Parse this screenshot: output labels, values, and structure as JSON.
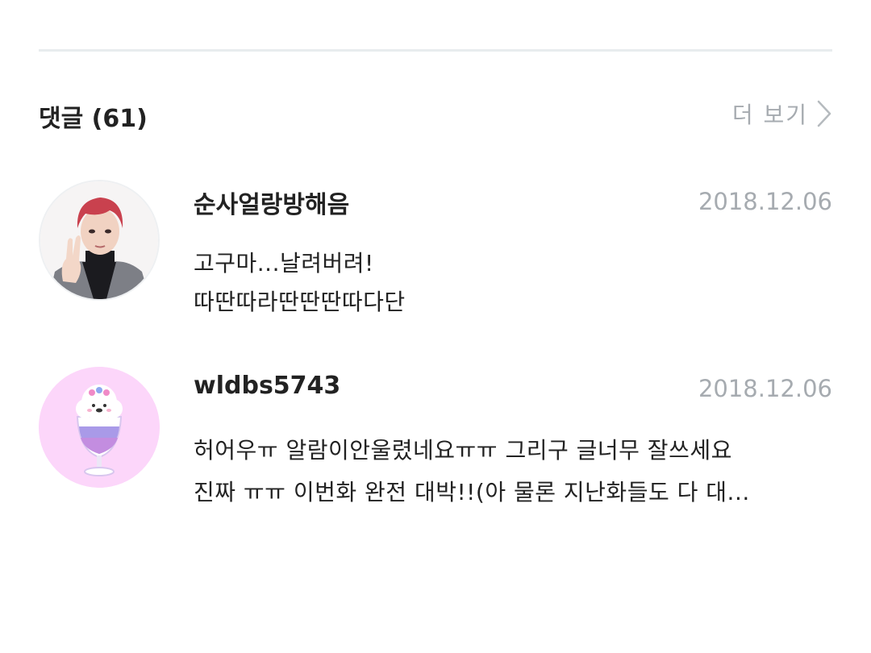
{
  "comments_section": {
    "title": "댓글 (61)",
    "more_label": "더 보기",
    "more_icon": "chevron-right-icon"
  },
  "comments": [
    {
      "author": "순사얼랑방해음",
      "date": "2018.12.06",
      "lines": [
        "고구마...날려버려!",
        "따딴따라딴딴딴따다단"
      ],
      "avatar": "avatar-photo-red-hair-boy"
    },
    {
      "author": "wldbs5743",
      "date": "2018.12.06",
      "lines": [
        "허어우ㅠ  알람이안울렸네요ㅠㅠ 그리구 글너무 잘쓰세요",
        "진짜 ㅠㅠ 이번화 완전 대박!!(아 물론 지난화들도 다 대..."
      ],
      "avatar": "avatar-bt21-rj-parfait"
    }
  ],
  "colors": {
    "text_primary": "#222222",
    "text_muted": "#a6abb0",
    "divider": "#e8ecee"
  }
}
